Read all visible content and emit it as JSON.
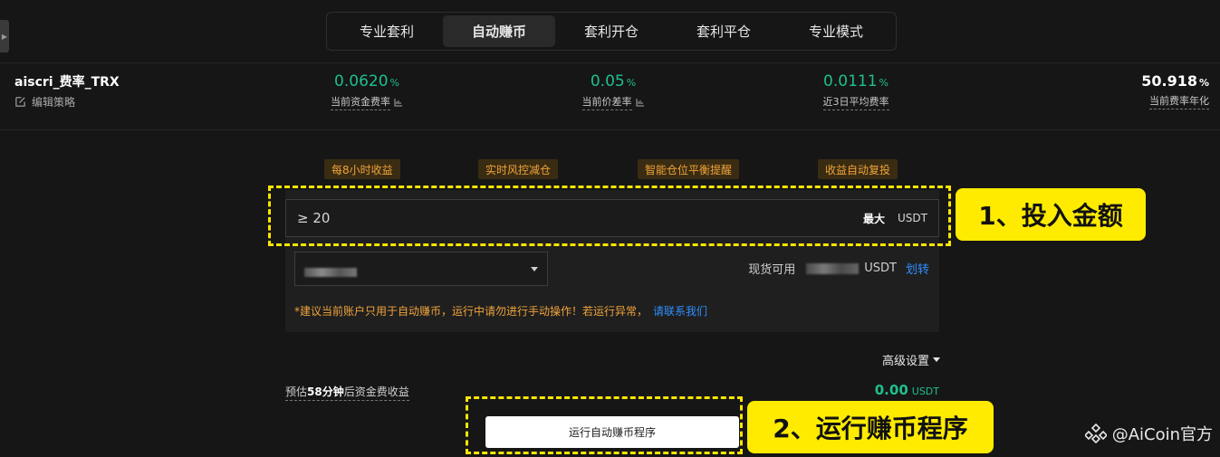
{
  "tabs": [
    {
      "label": "专业套利"
    },
    {
      "label": "自动赚币"
    },
    {
      "label": "套利开仓"
    },
    {
      "label": "套利平仓"
    },
    {
      "label": "专业模式"
    }
  ],
  "strategy": {
    "name": "aiscri_费率_TRX",
    "edit_label": "编辑策略"
  },
  "metrics": [
    {
      "value": "0.0620",
      "unit": "%",
      "label": "当前资金费率"
    },
    {
      "value": "0.05",
      "unit": "%",
      "label": "当前价差率"
    },
    {
      "value": "0.0111",
      "unit": "%",
      "label": "近3日平均费率"
    },
    {
      "value": "50.918",
      "unit": "%",
      "label": "当前费率年化"
    }
  ],
  "tags": [
    "每8小时收益",
    "实时风控减仓",
    "智能仓位平衡提醒",
    "收益自动复投"
  ],
  "amount": {
    "placeholder": "≥ 20",
    "max_label": "最大",
    "unit": "USDT"
  },
  "available": {
    "label": "现货可用",
    "unit": "USDT",
    "transfer_label": "划转"
  },
  "notice": {
    "text": "*建议当前账户只用于自动赚币，运行中请勿进行手动操作！若运行异常，",
    "link": "请联系我们"
  },
  "advanced_label": "高级设置",
  "estimate": {
    "prefix": "预估",
    "minutes": "58分钟",
    "suffix": "后资金费收益",
    "value": "0.00",
    "unit": "USDT"
  },
  "run_button": "运行自动赚币程序",
  "annotations": {
    "step1": "1、投入金额",
    "step2": "2、运行赚币程序",
    "highlight_color": "#ffeb00"
  },
  "watermark": "@AiCoin官方",
  "colors": {
    "accent_green": "#1fbf8f",
    "tag_orange": "#f0a33a",
    "link_blue": "#2f8fff"
  }
}
